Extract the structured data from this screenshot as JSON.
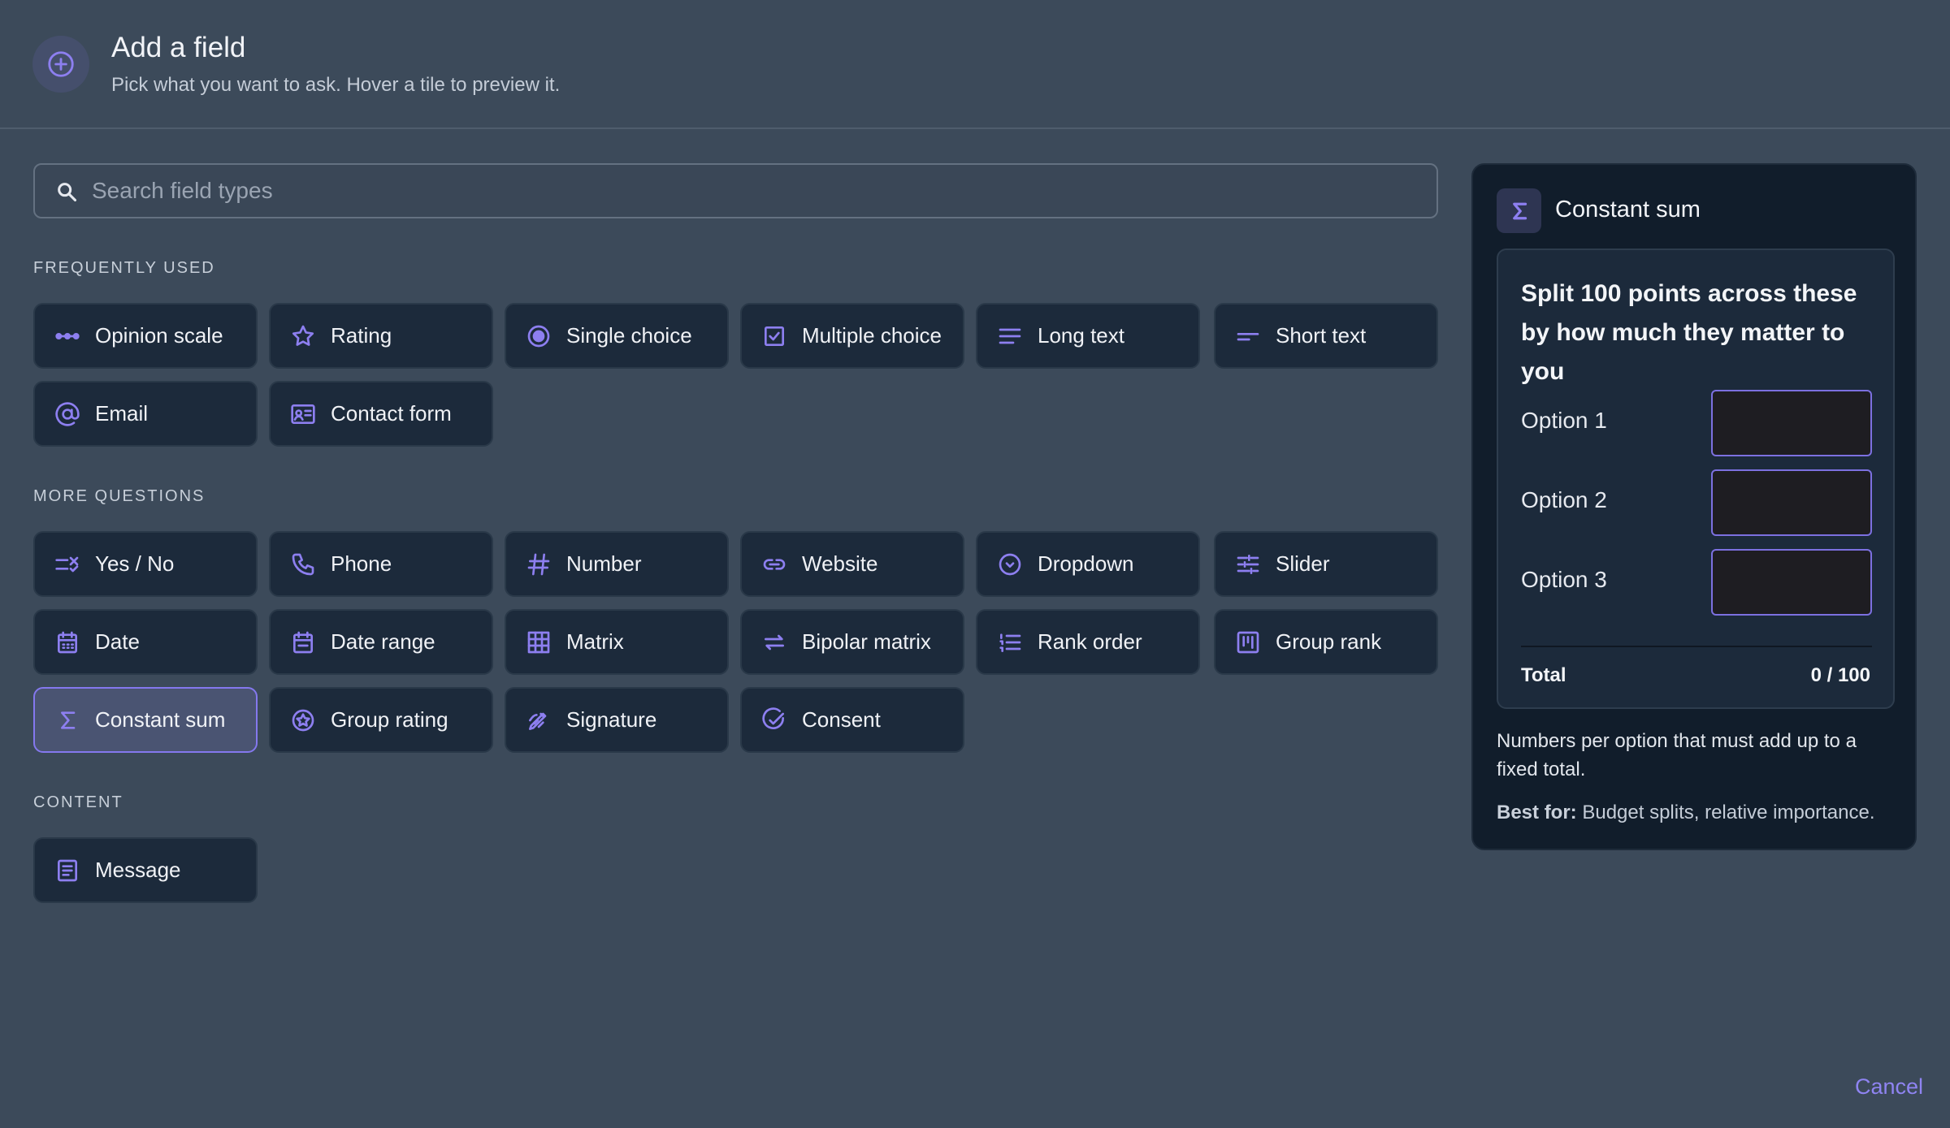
{
  "header": {
    "icon": "plus-circle-icon",
    "title": "Add a field",
    "subtitle": "Pick what you want to ask. Hover a tile to preview it."
  },
  "search": {
    "placeholder": "Search field types",
    "value": ""
  },
  "sections": {
    "frequent": "FREQUENTLY USED",
    "more": "MORE QUESTIONS",
    "content": "CONTENT"
  },
  "tiles": {
    "opinion_scale": "Opinion scale",
    "rating": "Rating",
    "single_choice": "Single choice",
    "multiple_choice": "Multiple choice",
    "long_text": "Long text",
    "short_text": "Short text",
    "email": "Email",
    "contact_form": "Contact form",
    "yes_no": "Yes / No",
    "phone": "Phone",
    "number": "Number",
    "website": "Website",
    "dropdown": "Dropdown",
    "slider": "Slider",
    "date": "Date",
    "date_range": "Date range",
    "matrix": "Matrix",
    "bipolar_matrix": "Bipolar matrix",
    "rank_order": "Rank order",
    "group_rank": "Group rank",
    "constant_sum": "Constant sum",
    "group_rating": "Group rating",
    "signature": "Signature",
    "consent": "Consent",
    "message": "Message"
  },
  "selected_tile": "Constant sum",
  "preview": {
    "icon": "sigma-icon",
    "title": "Constant sum",
    "question": "Split 100 points across these by how much they matter to you",
    "options": [
      "Option 1",
      "Option 2",
      "Option 3"
    ],
    "total_label": "Total",
    "total_value": "0 / 100",
    "description": "Numbers per option that must add up to a fixed total.",
    "best_for_label": "Best for:",
    "best_for_text": "Budget splits, relative importance."
  },
  "footer": {
    "cancel_label": "Cancel"
  },
  "colors": {
    "accent": "#8d7ff0",
    "background": "#3c4a5a",
    "tile": "#1c2a3b",
    "panel": "#111d2b"
  }
}
